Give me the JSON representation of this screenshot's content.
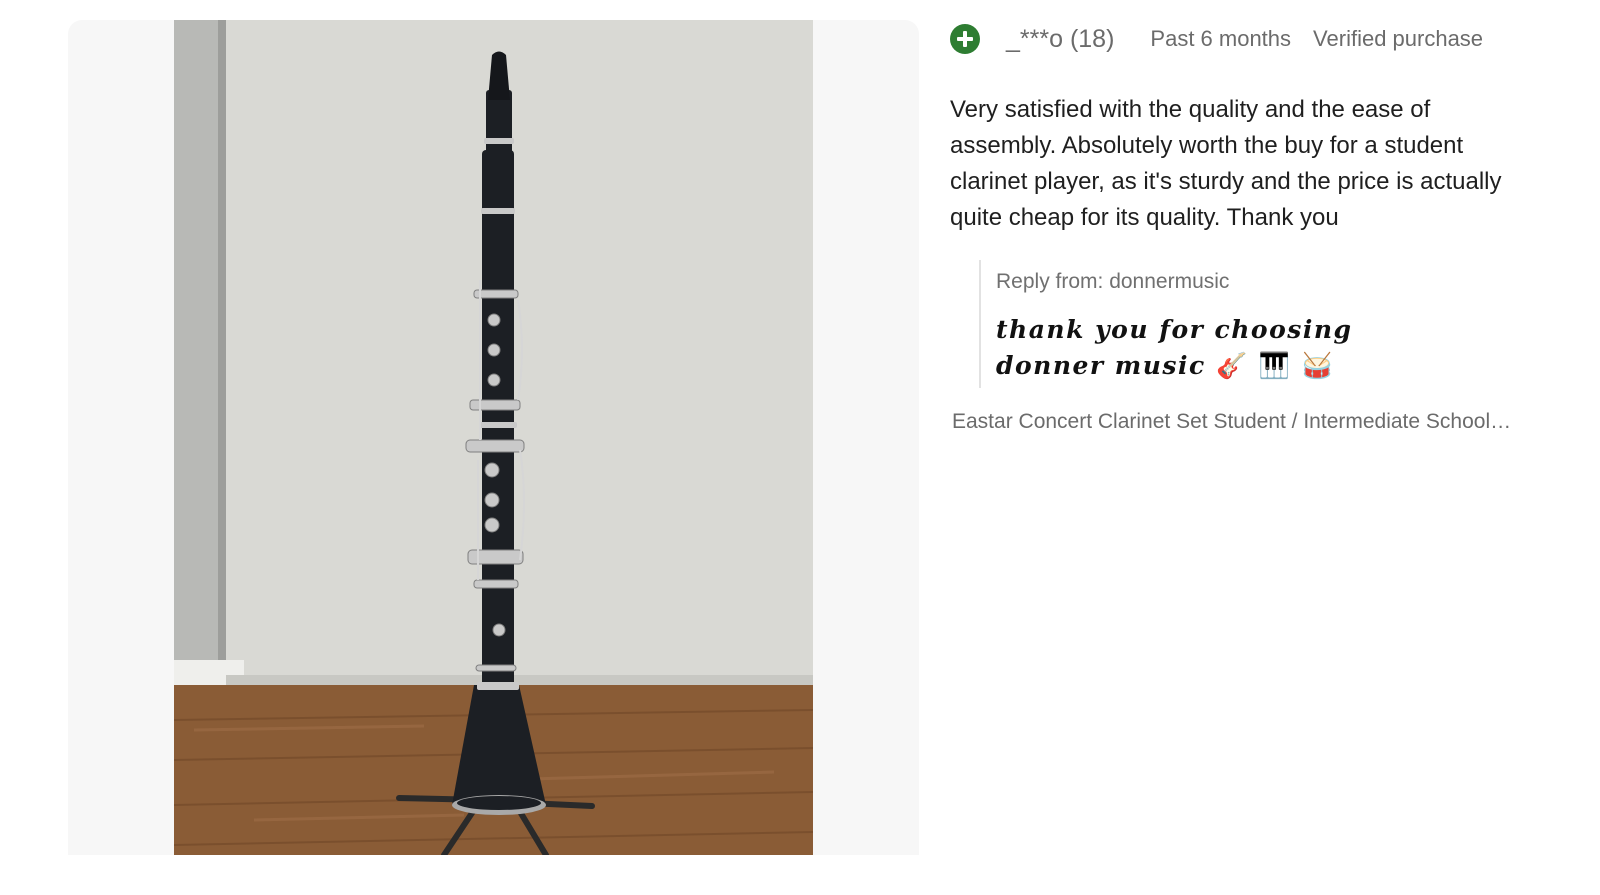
{
  "review": {
    "reviewer": "_***o (18)",
    "time": "Past 6 months",
    "badge": "Verified purchase",
    "text": "Very satisfied with the quality and the ease of assembly. Absolutely worth the buy for a student clarinet player, as it's sturdy and the price is actually quite cheap for its quality. Thank you",
    "reply_label": "Reply from: donnermusic",
    "reply_text": "thank you for choosing donner music",
    "reply_emojis": [
      "🎸",
      "🎹",
      "🥁"
    ],
    "product_title": "Eastar Concert Clarinet Set Student / Intermediate School Clarinet"
  },
  "photo": {
    "subject": "clarinet on stand",
    "colors": {
      "wall": "#d9d9d4",
      "floor": "#8a5c36",
      "clarinet": "#1c1f24",
      "keys": "#c9c9c9"
    }
  },
  "icons": {
    "add": "plus-circle-icon",
    "add_color": "#2e7d32"
  }
}
